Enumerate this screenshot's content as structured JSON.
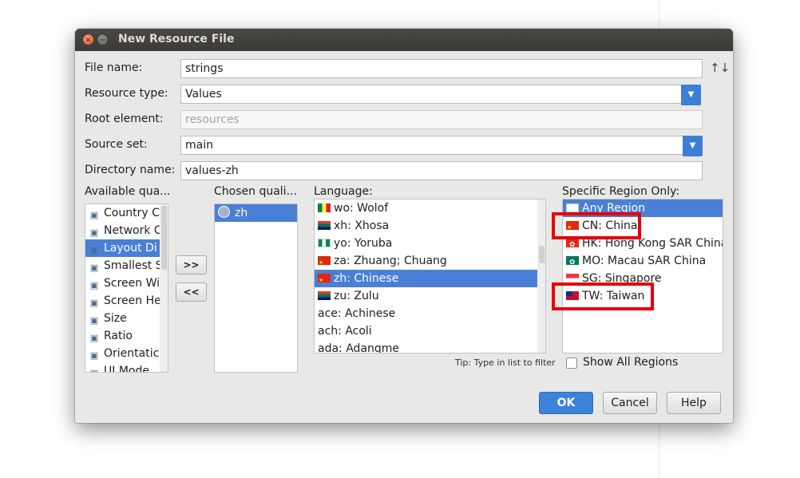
{
  "dialog": {
    "title": "New Resource File",
    "close_glyph": "×",
    "min_glyph": "−"
  },
  "form": {
    "file_name_label": "File name:",
    "file_name_value": "strings",
    "sort_glyph": "↑↓",
    "resource_type_label": "Resource type:",
    "resource_type_value": "Values",
    "root_element_label": "Root element:",
    "root_element_placeholder": "resources",
    "source_set_label": "Source set:",
    "source_set_value": "main",
    "directory_name_label": "Directory name:",
    "directory_name_value": "values-zh",
    "combo_arrow_glyph": "▼"
  },
  "qualifiers": {
    "available_label": "Available qua...",
    "available": [
      {
        "label": "Country C",
        "icon": "country-code-icon"
      },
      {
        "label": "Network C",
        "icon": "network-code-icon"
      },
      {
        "label": "Layout Di",
        "icon": "layout-direction-icon"
      },
      {
        "label": "Smallest S",
        "icon": "smallest-screen-icon"
      },
      {
        "label": "Screen Wi",
        "icon": "screen-width-icon"
      },
      {
        "label": "Screen He",
        "icon": "screen-height-icon"
      },
      {
        "label": "Size",
        "icon": "size-icon"
      },
      {
        "label": "Ratio",
        "icon": "ratio-icon"
      },
      {
        "label": "Orientatic",
        "icon": "orientation-icon"
      },
      {
        "label": "UI Mode",
        "icon": "ui-mode-icon"
      }
    ],
    "available_selected_index": 2,
    "add_button": ">>",
    "remove_button": "<<",
    "chosen_label": "Chosen quali...",
    "chosen": [
      {
        "label": "zh",
        "icon": "globe-icon"
      }
    ]
  },
  "language": {
    "label": "Language:",
    "items": [
      {
        "label": "wo: Wolof",
        "flag": "sn"
      },
      {
        "label": "xh: Xhosa",
        "flag": "za"
      },
      {
        "label": "yo: Yoruba",
        "flag": "ng"
      },
      {
        "label": "za: Zhuang; Chuang",
        "flag": "cn"
      },
      {
        "label": "zh: Chinese",
        "flag": "cn"
      },
      {
        "label": "zu: Zulu",
        "flag": "za"
      },
      {
        "label": "ace: Achinese",
        "flag": ""
      },
      {
        "label": "ach: Acoli",
        "flag": ""
      },
      {
        "label": "ada: Adangme",
        "flag": ""
      }
    ],
    "selected_index": 4,
    "tip": "Tip: Type in list to filter"
  },
  "region": {
    "label": "Specific Region Only:",
    "items": [
      {
        "label": "Any Region",
        "flag": "blank"
      },
      {
        "label": "CN: China",
        "flag": "cn"
      },
      {
        "label": "HK: Hong Kong SAR China",
        "flag": "hk"
      },
      {
        "label": "MO: Macau SAR China",
        "flag": "mo"
      },
      {
        "label": "SG: Singapore",
        "flag": "sg"
      },
      {
        "label": "TW: Taiwan",
        "flag": "tw"
      }
    ],
    "selected_index": 0,
    "show_all_label": "Show All Regions",
    "show_all_checked": false
  },
  "buttons": {
    "ok": "OK",
    "cancel": "Cancel",
    "help": "Help"
  },
  "annotation_color": "#e8000a"
}
